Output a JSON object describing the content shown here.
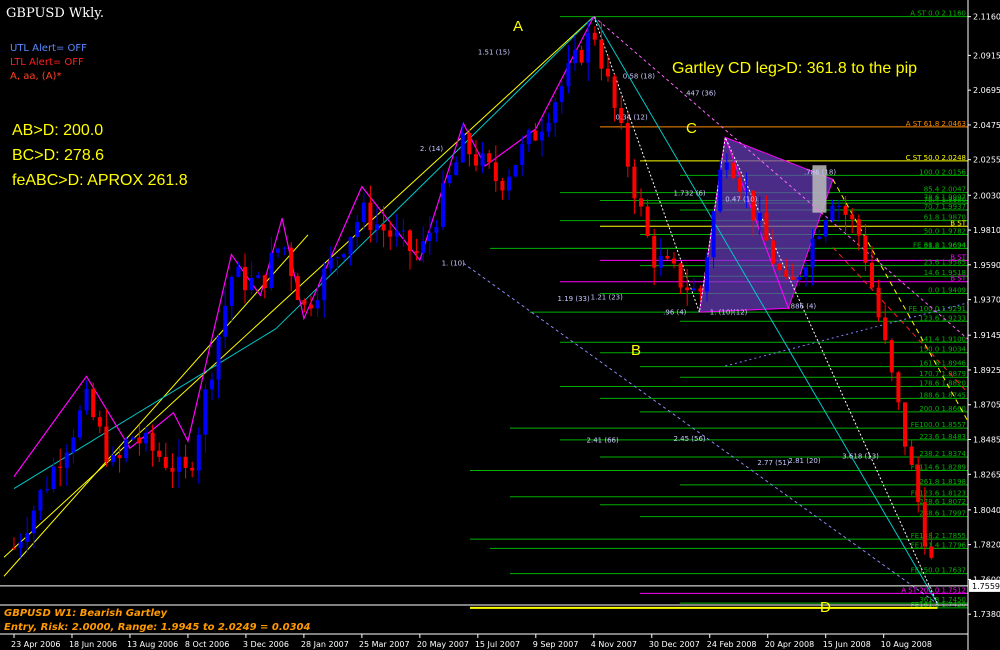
{
  "header": {
    "title": "GBPUSD Wkly.",
    "utl_alert": "UTL Alert= OFF",
    "ltl_alert": "LTL Alert= OFF",
    "wave_label": "A, aa, (A)*"
  },
  "ratios": {
    "ab_d": "AB>D: 200.0",
    "bc_d": "BC>D: 278.6",
    "feabc_d": "feABC>D: APROX 261.8"
  },
  "headline": "Gartley CD leg>D: 361.8 to the pip",
  "points": {
    "A": {
      "label": "A",
      "date": "4 Nov 2007",
      "price": 2.1161
    },
    "B": {
      "label": "B",
      "date": "14 Feb 2008",
      "price": 1.9291
    },
    "C": {
      "label": "C",
      "date": "10 Mar 2008",
      "price": 2.0396
    },
    "D": {
      "label": "D",
      "date": "1 Oct 2008",
      "price": 1.7446
    }
  },
  "footer": {
    "line1": "GBPUSD W1: Bearish Gartley",
    "line2": "Entry, Risk: 2.0000, Range: 1.9945 to 2.0249 = 0.0304"
  },
  "current_price": "1.7559",
  "colors": {
    "bull": "#0000ff",
    "bear": "#ff0000",
    "zigzag": "#ff00ff",
    "channel": "#00c8c8",
    "uptrend": "#ffff00",
    "fib": "#00b000",
    "highlight": "#ffff00",
    "pattern_fill": "#6a3fc0"
  },
  "chart_data": {
    "type": "candlestick",
    "title": "GBPUSD Wkly.",
    "x_ticks": [
      "23 Apr 2006",
      "18 Jun 2006",
      "13 Aug 2006",
      "8 Oct 2006",
      "3 Dec 2006",
      "28 Jan 2007",
      "25 Mar 2007",
      "20 May 2007",
      "15 Jul 2007",
      "9 Sep 2007",
      "4 Nov 2007",
      "30 Dec 2007",
      "24 Feb 2008",
      "20 Apr 2008",
      "15 Jun 2008",
      "10 Aug 2008"
    ],
    "y_ticks": [
      2.116,
      2.0915,
      2.0695,
      2.0475,
      2.0255,
      2.003,
      1.981,
      1.959,
      1.937,
      1.9145,
      1.8925,
      1.8705,
      1.8485,
      1.8265,
      1.804,
      1.782,
      1.76,
      1.738
    ],
    "ylim": [
      1.728,
      2.124
    ],
    "grid": false,
    "fib_levels": [
      {
        "label": "A ST 0.0 2.1160",
        "price": 2.116,
        "color": "#00b000"
      },
      {
        "label": "A ST 61.8 2.0463",
        "price": 2.0463,
        "color": "#ff8c00"
      },
      {
        "label": "C ST 50.0 2.0248",
        "price": 2.0248,
        "color": "#ffff00"
      },
      {
        "label": "100.0 2.0156",
        "price": 2.0156,
        "color": "#00b000"
      },
      {
        "label": "85.4 2.0047",
        "price": 2.0047,
        "color": "#00b000"
      },
      {
        "label": "78.6 1.9997",
        "price": 1.9997,
        "color": "#00b000"
      },
      {
        "label": "76.4 1.9980",
        "price": 1.998,
        "color": "#00b000"
      },
      {
        "label": "70.7 1.9937",
        "price": 1.9937,
        "color": "#00b000"
      },
      {
        "label": "61.8 1.9870",
        "price": 1.987,
        "color": "#00b000"
      },
      {
        "label": "B ST",
        "price": 1.9834,
        "color": "#ffff00"
      },
      {
        "label": "50.0 1.9782",
        "price": 1.9782,
        "color": "#00b000"
      },
      {
        "label": "FE 61.8 1.9694",
        "price": 1.9694,
        "color": "#00b000"
      },
      {
        "label": "38.2 1.9694",
        "price": 1.9694,
        "color": "#00b000"
      },
      {
        "label": "B ST",
        "price": 1.9618,
        "color": "#ff00ff"
      },
      {
        "label": "23.6 1.9585",
        "price": 1.9585,
        "color": "#00b000"
      },
      {
        "label": "14.6 1.9518",
        "price": 1.9518,
        "color": "#00b000"
      },
      {
        "label": "B ST",
        "price": 1.9483,
        "color": "#ff00ff"
      },
      {
        "label": "0.0 1.9409",
        "price": 1.9409,
        "color": "#00b000"
      },
      {
        "label": "FE 100.0 1.9291",
        "price": 1.9291,
        "color": "#00b000"
      },
      {
        "label": "123.6 1.9233",
        "price": 1.9233,
        "color": "#00b000"
      },
      {
        "label": "141.4 1.9100",
        "price": 1.91,
        "color": "#00b000"
      },
      {
        "label": "150.0 1.9034",
        "price": 1.9034,
        "color": "#00b000"
      },
      {
        "label": "161.8 1.8946",
        "price": 1.8946,
        "color": "#00b000"
      },
      {
        "label": "170.7 1.8879",
        "price": 1.8879,
        "color": "#00b000"
      },
      {
        "label": "178.6 1.8820",
        "price": 1.882,
        "color": "#00b000"
      },
      {
        "label": "188.6 1.8745",
        "price": 1.8745,
        "color": "#00b000"
      },
      {
        "label": "200.0 1.8660",
        "price": 1.866,
        "color": "#00b000"
      },
      {
        "label": "FE100.0 1.8557",
        "price": 1.8557,
        "color": "#00b000"
      },
      {
        "label": "223.6 1.8483",
        "price": 1.8483,
        "color": "#00b000"
      },
      {
        "label": "238.2 1.8374",
        "price": 1.8374,
        "color": "#00b000"
      },
      {
        "label": "FE114.6 1.8289",
        "price": 1.8289,
        "color": "#00b000"
      },
      {
        "label": "261.8 1.8198",
        "price": 1.8198,
        "color": "#00b000"
      },
      {
        "label": "FE123.6 1.8123",
        "price": 1.8123,
        "color": "#00b000"
      },
      {
        "label": "278.6 1.8072",
        "price": 1.8072,
        "color": "#00b000"
      },
      {
        "label": "288.6 1.7997",
        "price": 1.7997,
        "color": "#00b000"
      },
      {
        "label": "FE138.2 1.7855",
        "price": 1.7855,
        "color": "#00b000"
      },
      {
        "label": "FE141.4 1.7796",
        "price": 1.7796,
        "color": "#00b000"
      },
      {
        "label": "FE150.0 1.7637",
        "price": 1.7637,
        "color": "#00b000"
      },
      {
        "label": "A ST 200.0 1.7512",
        "price": 1.7512,
        "color": "#ff00ff"
      },
      {
        "label": "361.8 1.7450",
        "price": 1.745,
        "color": "#00b000"
      },
      {
        "label": "FE161.8 1.7420",
        "price": 1.742,
        "color": "#00b000"
      }
    ],
    "annotations": [
      {
        "text": "1.51 (15)",
        "date": "15 Jul 2007",
        "price": 2.092
      },
      {
        "text": "2. (14)",
        "date": "20 May 2007",
        "price": 2.031
      },
      {
        "text": "1. (10)",
        "date": "10 Jun 2007",
        "price": 1.9585
      },
      {
        "text": "0.58 (18)",
        "date": "2 Dec 2007",
        "price": 2.077
      },
      {
        "text": ".447 (36)",
        "date": "30 Jan 2008",
        "price": 2.066
      },
      {
        "text": "0.34 (12)",
        "date": "25 Nov 2007",
        "price": 2.051
      },
      {
        "text": ".786 (18)",
        "date": "25 May 2008",
        "price": 2.016
      },
      {
        "text": "1.732 (6)",
        "date": "20 Jan 2008",
        "price": 2.003
      },
      {
        "text": "0.47 (10)",
        "date": "10 Mar 2008",
        "price": 1.999
      },
      {
        "text": "1.19 (33)",
        "date": "30 Sep 2007",
        "price": 1.936
      },
      {
        "text": "1.21 (23)",
        "date": "1 Nov 2007",
        "price": 1.937
      },
      {
        "text": ".96 (4)",
        "date": "10 Jan 2008",
        "price": 1.9275
      },
      {
        "text": "1. (10)(12)",
        "date": "24 Feb 2008",
        "price": 1.9275
      },
      {
        "text": ".886 (4)",
        "date": "10 May 2008",
        "price": 1.9315
      },
      {
        "text": "2.41 (66)",
        "date": "28 Oct 2007",
        "price": 1.8465
      },
      {
        "text": "2.45 (56)",
        "date": "20 Jan 2008",
        "price": 1.8475
      },
      {
        "text": "2.77 (51)",
        "date": "10 Apr 2008",
        "price": 1.8325
      },
      {
        "text": "2.81 (20)",
        "date": "10 May 2008",
        "price": 1.8335
      },
      {
        "text": "3.618 (13)",
        "date": "1 Jul 2008",
        "price": 1.8365
      }
    ]
  }
}
